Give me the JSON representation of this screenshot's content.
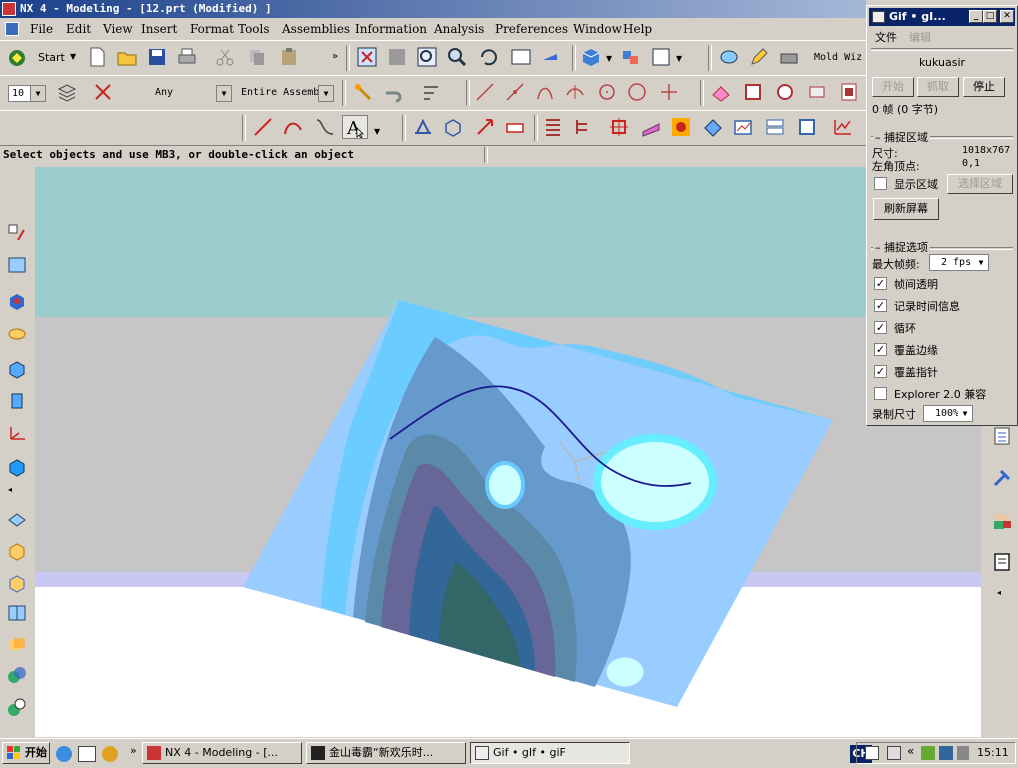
{
  "window": {
    "title": "NX 4 - Modeling - [12.prt (Modified) ]"
  },
  "menu": [
    "File",
    "Edit",
    "View",
    "Insert",
    "Format",
    "Tools",
    "Assemblies",
    "Information",
    "Analysis",
    "Preferences",
    "Window",
    "Help"
  ],
  "toolbar1": {
    "start_label": "Start",
    "mold_label": "Mold Wiz"
  },
  "toolbar2": {
    "layer_value": "10",
    "filter_value": "Any",
    "scope_value": "Entire Assemb"
  },
  "status": {
    "prompt": "Select objects and use MB3, or double-click an object"
  },
  "icons": [
    "nx-logo-icon",
    "new-file-icon",
    "open-folder-icon",
    "save-icon",
    "print-icon",
    "cut-icon",
    "copy-icon",
    "paste-icon",
    "fit-icon",
    "zoom-icon",
    "rotate-icon",
    "pan-icon",
    "shaded-cube-icon",
    "layer-settings-icon",
    "selection-filter-icon",
    "line-icon",
    "arc-icon",
    "spline-icon",
    "text-icon",
    "point-icon",
    "datum-icon"
  ],
  "gif_panel": {
    "title": "Gif • gI...",
    "menu_file": "文件",
    "menu_edit": "编辑",
    "user": "kukuasir",
    "btn_start": "开始",
    "btn_capture": "抓取",
    "btn_stop": "停止",
    "frames": "0 帧  (0 字节)",
    "section_capture": "捕捉区域",
    "size_label": "尺寸:",
    "size_value": "1018x767",
    "origin_label": "左角顶点:",
    "origin_value": "0,1",
    "show_region": "显示区域",
    "select_region": "选择区域",
    "refresh": "刷新屏幕",
    "section_options": "捕捉选项",
    "max_fps_label": "最大帧频:",
    "max_fps_value": "2 fps",
    "opt_transparent": "帧间透明",
    "opt_time": "记录时间信息",
    "opt_loop": "循环",
    "opt_edge": "覆盖边缘",
    "opt_pointer": "覆盖指针",
    "opt_explorer": "Explorer 2.0 兼容",
    "record_size_label": "录制尺寸",
    "record_size_value": "100%"
  },
  "taskbar": {
    "start": "开始",
    "tasks": [
      "NX 4 - Modeling - [...",
      "金山毒霸“新欢乐时...",
      "Gif • gIf • giF"
    ],
    "lang": "CH",
    "clock": "15:11"
  },
  "colors": {
    "titlebar": "#1a3f8a",
    "viewport_top": "#9ccccc",
    "viewport_mid": "#c6c6c6",
    "viewport_floor": "#ffffff",
    "surface": "#99ccff",
    "curve": "#1a1a8c"
  }
}
